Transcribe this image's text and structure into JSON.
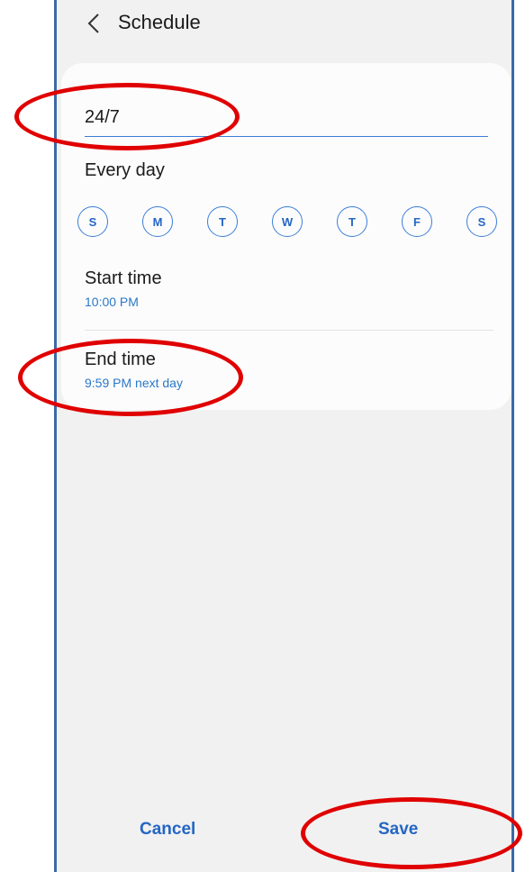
{
  "header": {
    "back_icon": "chevron-left-icon",
    "title": "Schedule"
  },
  "schedule": {
    "name_value": "24/7",
    "repeat_label": "Every day",
    "days": [
      "S",
      "M",
      "T",
      "W",
      "T",
      "F",
      "S"
    ],
    "selected_days": [
      true,
      true,
      true,
      true,
      true,
      true,
      true
    ],
    "start": {
      "label": "Start time",
      "value": "10:00 PM"
    },
    "end": {
      "label": "End time",
      "value": "9:59 PM next day"
    }
  },
  "footer": {
    "cancel_label": "Cancel",
    "save_label": "Save"
  },
  "colors": {
    "accent": "#2466c4",
    "annotation": "#e00000",
    "frame": "#3a6aa8"
  },
  "annotations": [
    "name-field-highlight",
    "end-time-highlight",
    "save-button-highlight"
  ]
}
